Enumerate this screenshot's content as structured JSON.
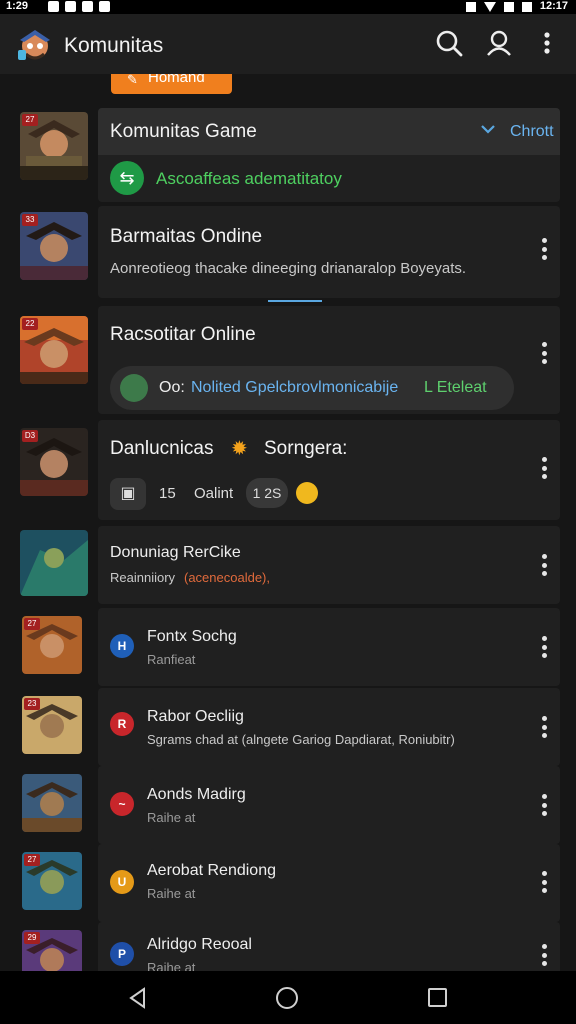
{
  "status_bar": {
    "time": "1:29",
    "right_time": "12:17"
  },
  "app_bar": {
    "title": "Komunitas"
  },
  "top_chip": {
    "label": "Homand"
  },
  "rows": [
    {
      "badge": "27",
      "header": {
        "title": "Komunitas Game",
        "action": "Chrott"
      },
      "status_text": "Ascoaffeas adematitatoy"
    },
    {
      "badge": "33",
      "title": "Barmaitas Ondine",
      "subtitle": "Aonreotieog thacake dineeging drianaralop Boyeyats."
    },
    {
      "badge": "22",
      "title": "Racsotitar Online",
      "pill": {
        "prefix": "Oo:",
        "link": "Nolited Gpelcbrovlmonicabije",
        "suffix": "L Eteleat"
      }
    },
    {
      "badge": "D3",
      "title": "Danlucnicas",
      "title2": "Sorngera:",
      "meta": {
        "count": "15",
        "label": "Oalint",
        "pill": "1 2S"
      }
    },
    {
      "title": "Donuniag RerCike",
      "subtitle_prefix": "Reainniiory",
      "subtitle_highlight": "(acenecoalde),",
      "sub_color": "#e06a3c"
    },
    {
      "badge": "27",
      "title": "Fontx Sochg",
      "subtitle": "Ranfieat",
      "dot_color": "#1f5fb8",
      "dot_label": "H"
    },
    {
      "badge": "23",
      "title": "Rabor Oecliig",
      "subtitle": "Sgrams chad at (alngete Gariog Dapdiarat, Roniubitr)",
      "dot_color": "#c8262b",
      "dot_label": "R"
    },
    {
      "badge": "",
      "title": "Aonds Madirg",
      "subtitle": "Raihe at",
      "dot_color": "#c8262b",
      "dot_label": "~"
    },
    {
      "badge": "27",
      "title": "Aerobat Rendiong",
      "subtitle": "Raihe at",
      "dot_color": "#e59a18",
      "dot_label": "U"
    },
    {
      "badge": "29",
      "title": "Alridgo Reooal",
      "subtitle": "Raihe at",
      "dot_color": "#1f4fa8",
      "dot_label": "P"
    }
  ]
}
